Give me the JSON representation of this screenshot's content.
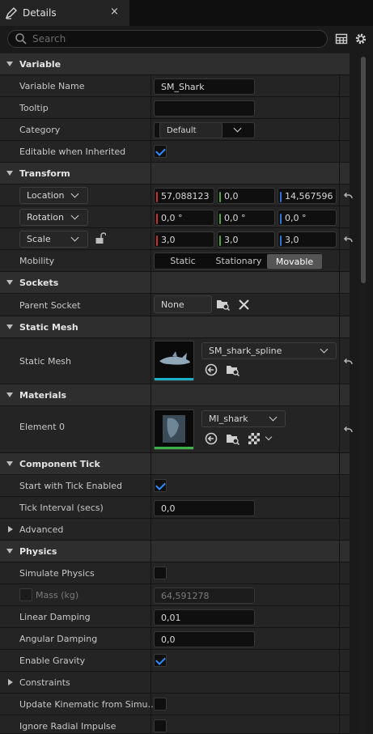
{
  "tab": {
    "title": "Details",
    "close": "×"
  },
  "search": {
    "placeholder": "Search"
  },
  "sections": {
    "variable": "Variable",
    "transform": "Transform",
    "sockets": "Sockets",
    "static_mesh": "Static Mesh",
    "materials": "Materials",
    "component_tick": "Component Tick",
    "advanced": "Advanced",
    "physics": "Physics",
    "constraints": "Constraints"
  },
  "variable": {
    "name_label": "Variable Name",
    "name_value": "SM_Shark",
    "tooltip_label": "Tooltip",
    "tooltip_value": "",
    "category_label": "Category",
    "category_value": "Default",
    "editable_label": "Editable when Inherited",
    "editable_checked": true
  },
  "transform": {
    "location_label": "Location",
    "location": [
      "57,088123",
      "0,0",
      "14,567596"
    ],
    "rotation_label": "Rotation",
    "rotation": [
      "0,0 °",
      "0,0 °",
      "0,0 °"
    ],
    "scale_label": "Scale",
    "scale": [
      "3,0",
      "3,0",
      "3,0"
    ],
    "mobility_label": "Mobility",
    "mobility_options": [
      "Static",
      "Stationary",
      "Movable"
    ],
    "mobility_selected": "Movable"
  },
  "sockets": {
    "parent_label": "Parent Socket",
    "parent_value": "None"
  },
  "static_mesh": {
    "label": "Static Mesh",
    "value": "SM_shark_spline"
  },
  "materials": {
    "element_label": "Element 0",
    "value": "MI_shark"
  },
  "tick": {
    "start_label": "Start with Tick Enabled",
    "start_checked": true,
    "interval_label": "Tick Interval (secs)",
    "interval_value": "0,0"
  },
  "physics": {
    "simulate_label": "Simulate Physics",
    "mass_label": "Mass (kg)",
    "mass_value": "64,591278",
    "linear_label": "Linear Damping",
    "linear_value": "0,01",
    "angular_label": "Angular Damping",
    "angular_value": "0,0",
    "gravity_label": "Enable Gravity",
    "kinematic_label": "Update Kinematic from Simu…",
    "radial_label": "Ignore Radial Impulse"
  },
  "colors": {
    "x_axis": "#c8302c",
    "y_axis": "#5a9f3a",
    "z_axis": "#2f74d6",
    "accent": "#2f8bff",
    "thumb_cyan": "#19b0c8",
    "thumb_green": "#3bb34a"
  }
}
